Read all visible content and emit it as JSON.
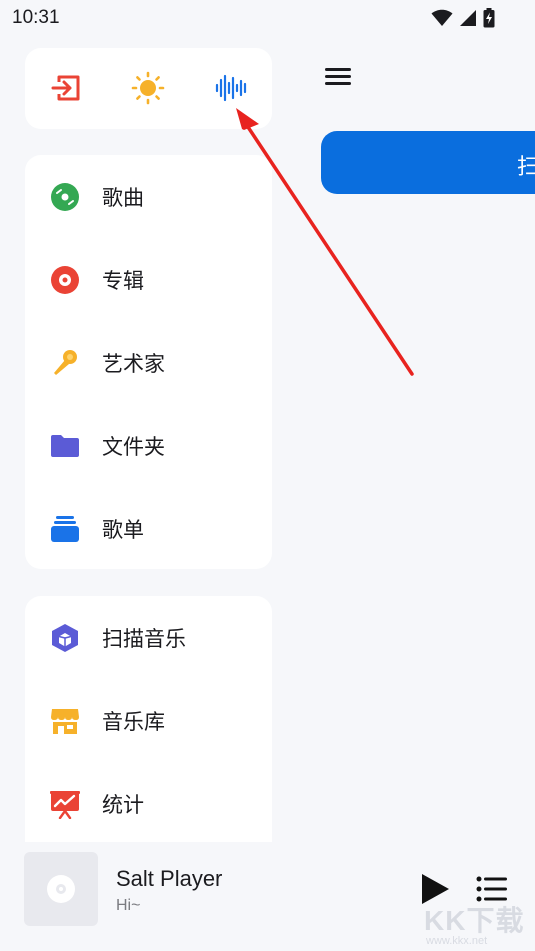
{
  "status_bar": {
    "time": "10:31",
    "icons": [
      "wifi-icon",
      "cellular-signal-icon",
      "battery-charging-icon"
    ]
  },
  "quick_actions": [
    {
      "name": "exit-icon",
      "color": "#ea4335"
    },
    {
      "name": "sun-icon",
      "color": "#f6b12a"
    },
    {
      "name": "sound-wave-icon",
      "color": "#1a73e8"
    }
  ],
  "library_nav": [
    {
      "label": "歌曲",
      "icon": "music-disc-icon",
      "color": "#34a853"
    },
    {
      "label": "专辑",
      "icon": "album-icon",
      "color": "#ea4335"
    },
    {
      "label": "艺术家",
      "icon": "microphone-icon",
      "color": "#f6b12a"
    },
    {
      "label": "文件夹",
      "icon": "folder-icon",
      "color": "#5b5bd6"
    },
    {
      "label": "歌单",
      "icon": "playlist-stack-icon",
      "color": "#1a73e8"
    }
  ],
  "tools_nav": [
    {
      "label": "扫描音乐",
      "icon": "scan-cube-icon",
      "color": "#5b5bd6"
    },
    {
      "label": "音乐库",
      "icon": "store-icon",
      "color": "#f6b12a"
    },
    {
      "label": "统计",
      "icon": "statistics-board-icon",
      "color": "#ea4335"
    }
  ],
  "main": {
    "scan_button_label": "扫"
  },
  "player": {
    "title": "Salt Player",
    "subtitle": "Hi~"
  },
  "watermark": {
    "text": "KK下载",
    "url": "www.kkx.net"
  }
}
